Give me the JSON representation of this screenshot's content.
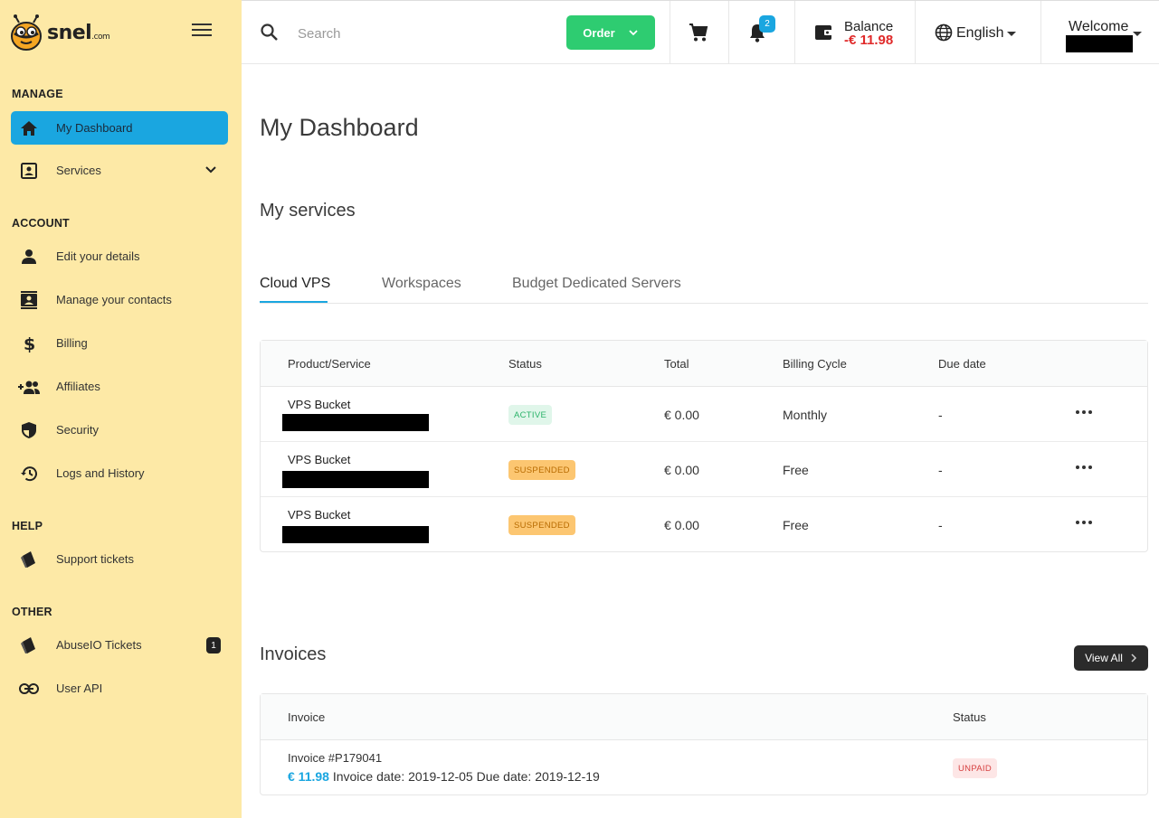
{
  "brand": {
    "name": "snel",
    "suffix": ".com"
  },
  "sidebar": {
    "sections": {
      "manage": "MANAGE",
      "account": "ACCOUNT",
      "help": "HELP",
      "other": "OTHER"
    },
    "items": {
      "dashboard": "My Dashboard",
      "services": "Services",
      "edit_details": "Edit your details",
      "contacts": "Manage your contacts",
      "billing": "Billing",
      "affiliates": "Affiliates",
      "security": "Security",
      "logs": "Logs and History",
      "support": "Support tickets",
      "abuseio": "AbuseIO Tickets",
      "user_api": "User API"
    },
    "abuseio_badge": "1"
  },
  "topbar": {
    "search_placeholder": "Search",
    "order_label": "Order",
    "notifications_count": "2",
    "balance_label": "Balance",
    "balance_value": "-€ 11.98",
    "language": "English",
    "welcome": "Welcome"
  },
  "main": {
    "title": "My Dashboard",
    "services_heading": "My services",
    "tabs": [
      "Cloud VPS",
      "Workspaces",
      "Budget Dedicated Servers"
    ],
    "services_table": {
      "headers": [
        "Product/Service",
        "Status",
        "Total",
        "Billing Cycle",
        "Due date"
      ],
      "rows": [
        {
          "product": "VPS Bucket",
          "status": "ACTIVE",
          "total": "€ 0.00",
          "cycle": "Monthly",
          "due": "-"
        },
        {
          "product": "VPS Bucket",
          "status": "SUSPENDED",
          "total": "€ 0.00",
          "cycle": "Free",
          "due": "-"
        },
        {
          "product": "VPS Bucket",
          "status": "SUSPENDED",
          "total": "€ 0.00",
          "cycle": "Free",
          "due": "-"
        }
      ]
    },
    "invoices_heading": "Invoices",
    "view_all": "View All",
    "invoices_table": {
      "headers": [
        "Invoice",
        "Status"
      ],
      "rows": [
        {
          "invoice": "Invoice #P179041",
          "amount": "€ 11.98",
          "dates": "Invoice date: 2019-12-05 Due date: 2019-12-19",
          "status": "UNPAID"
        }
      ]
    }
  },
  "colors": {
    "sidebar_bg": "#fde9a6",
    "accent": "#1aa6e0",
    "order_green": "#2ecc71",
    "balance_red": "#e02a2a"
  }
}
